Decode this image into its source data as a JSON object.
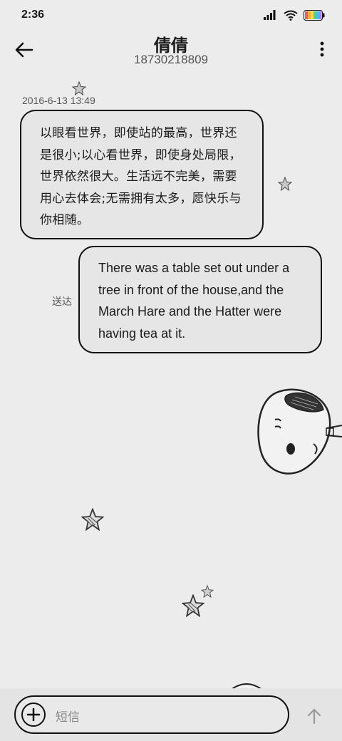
{
  "status_bar": {
    "time": "2:36"
  },
  "header": {
    "contact_name": "倩倩",
    "phone_number": "18730218809"
  },
  "conversation": {
    "timestamp": "2016-6-13 13:49",
    "messages": [
      {
        "direction": "incoming",
        "text": "以眼看世界，即使站的最高，世界还是很小;以心看世界，即使身处局限，世界依然很大。生活远不完美，需要用心去体会;无需拥有太多，愿快乐与你相随。"
      },
      {
        "direction": "outgoing",
        "text": "There was a table set out under a tree in front of the house,and the March Hare and the Hatter were having tea at it.",
        "status": "送达"
      }
    ]
  },
  "composer": {
    "placeholder": "短信"
  },
  "icons": {
    "back": "arrow-left-icon",
    "more": "more-vertical-icon",
    "add": "plus-icon",
    "send": "arrow-up-icon",
    "signal": "signal-icon",
    "wifi": "wifi-icon",
    "battery": "battery-icon"
  },
  "colors": {
    "background": "#ececec",
    "bubble": "#e6e6e6",
    "outline": "#111111"
  }
}
